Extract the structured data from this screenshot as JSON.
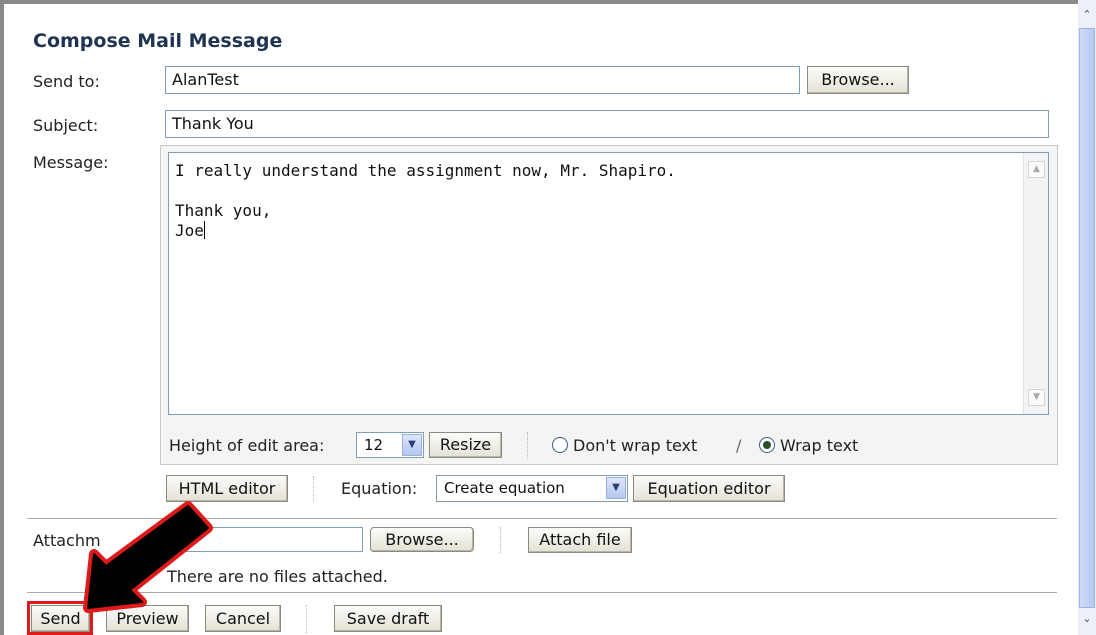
{
  "form": {
    "title": "Compose Mail Message",
    "send_to_label": "Send to:",
    "send_to_value": "AlanTest",
    "browse_label": "Browse...",
    "subject_label": "Subject:",
    "subject_value": "Thank You",
    "message_label": "Message:",
    "message_line1": "I really understand the assignment now, Mr. Shapiro.",
    "message_line2": "Thank you,",
    "message_line3": "Joe"
  },
  "edit_controls": {
    "height_label": "Height of edit area:",
    "height_value": "12",
    "resize_label": "Resize",
    "dont_wrap_label": "Don't wrap text",
    "slash": "/",
    "wrap_label": "Wrap text",
    "wrap_selected": true
  },
  "editor_controls": {
    "html_editor_label": "HTML editor",
    "equation_label": "Equation:",
    "equation_select_value": "Create equation",
    "equation_editor_label": "Equation editor"
  },
  "attachments": {
    "label": "Attachm",
    "browse_label": "Browse...",
    "attach_file_label": "Attach file",
    "status": "There are no files attached."
  },
  "actions": {
    "send_label": "Send",
    "preview_label": "Preview",
    "cancel_label": "Cancel",
    "save_draft_label": "Save draft"
  },
  "colors": {
    "highlight": "#e01a1a",
    "title": "#1f3352"
  }
}
